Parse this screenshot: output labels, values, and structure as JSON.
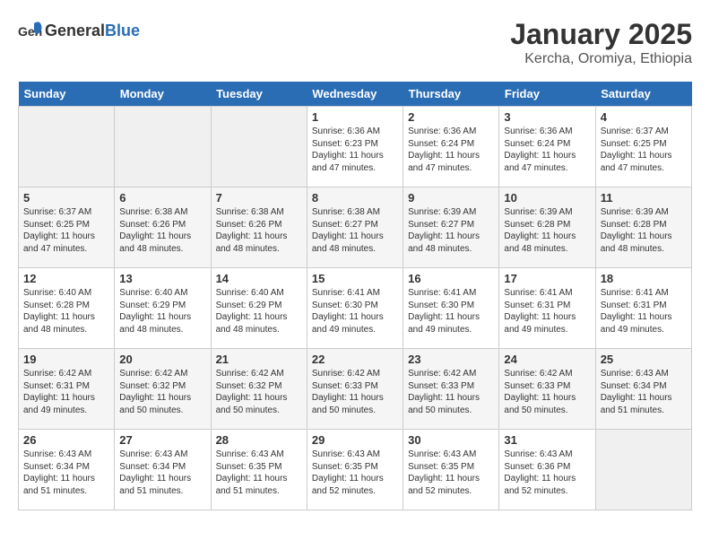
{
  "header": {
    "logo_general": "General",
    "logo_blue": "Blue",
    "title": "January 2025",
    "subtitle": "Kercha, Oromiya, Ethiopia"
  },
  "days_of_week": [
    "Sunday",
    "Monday",
    "Tuesday",
    "Wednesday",
    "Thursday",
    "Friday",
    "Saturday"
  ],
  "weeks": [
    [
      {
        "day": "",
        "info": ""
      },
      {
        "day": "",
        "info": ""
      },
      {
        "day": "",
        "info": ""
      },
      {
        "day": "1",
        "info": "Sunrise: 6:36 AM\nSunset: 6:23 PM\nDaylight: 11 hours and 47 minutes."
      },
      {
        "day": "2",
        "info": "Sunrise: 6:36 AM\nSunset: 6:24 PM\nDaylight: 11 hours and 47 minutes."
      },
      {
        "day": "3",
        "info": "Sunrise: 6:36 AM\nSunset: 6:24 PM\nDaylight: 11 hours and 47 minutes."
      },
      {
        "day": "4",
        "info": "Sunrise: 6:37 AM\nSunset: 6:25 PM\nDaylight: 11 hours and 47 minutes."
      }
    ],
    [
      {
        "day": "5",
        "info": "Sunrise: 6:37 AM\nSunset: 6:25 PM\nDaylight: 11 hours and 47 minutes."
      },
      {
        "day": "6",
        "info": "Sunrise: 6:38 AM\nSunset: 6:26 PM\nDaylight: 11 hours and 48 minutes."
      },
      {
        "day": "7",
        "info": "Sunrise: 6:38 AM\nSunset: 6:26 PM\nDaylight: 11 hours and 48 minutes."
      },
      {
        "day": "8",
        "info": "Sunrise: 6:38 AM\nSunset: 6:27 PM\nDaylight: 11 hours and 48 minutes."
      },
      {
        "day": "9",
        "info": "Sunrise: 6:39 AM\nSunset: 6:27 PM\nDaylight: 11 hours and 48 minutes."
      },
      {
        "day": "10",
        "info": "Sunrise: 6:39 AM\nSunset: 6:28 PM\nDaylight: 11 hours and 48 minutes."
      },
      {
        "day": "11",
        "info": "Sunrise: 6:39 AM\nSunset: 6:28 PM\nDaylight: 11 hours and 48 minutes."
      }
    ],
    [
      {
        "day": "12",
        "info": "Sunrise: 6:40 AM\nSunset: 6:28 PM\nDaylight: 11 hours and 48 minutes."
      },
      {
        "day": "13",
        "info": "Sunrise: 6:40 AM\nSunset: 6:29 PM\nDaylight: 11 hours and 48 minutes."
      },
      {
        "day": "14",
        "info": "Sunrise: 6:40 AM\nSunset: 6:29 PM\nDaylight: 11 hours and 48 minutes."
      },
      {
        "day": "15",
        "info": "Sunrise: 6:41 AM\nSunset: 6:30 PM\nDaylight: 11 hours and 49 minutes."
      },
      {
        "day": "16",
        "info": "Sunrise: 6:41 AM\nSunset: 6:30 PM\nDaylight: 11 hours and 49 minutes."
      },
      {
        "day": "17",
        "info": "Sunrise: 6:41 AM\nSunset: 6:31 PM\nDaylight: 11 hours and 49 minutes."
      },
      {
        "day": "18",
        "info": "Sunrise: 6:41 AM\nSunset: 6:31 PM\nDaylight: 11 hours and 49 minutes."
      }
    ],
    [
      {
        "day": "19",
        "info": "Sunrise: 6:42 AM\nSunset: 6:31 PM\nDaylight: 11 hours and 49 minutes."
      },
      {
        "day": "20",
        "info": "Sunrise: 6:42 AM\nSunset: 6:32 PM\nDaylight: 11 hours and 50 minutes."
      },
      {
        "day": "21",
        "info": "Sunrise: 6:42 AM\nSunset: 6:32 PM\nDaylight: 11 hours and 50 minutes."
      },
      {
        "day": "22",
        "info": "Sunrise: 6:42 AM\nSunset: 6:33 PM\nDaylight: 11 hours and 50 minutes."
      },
      {
        "day": "23",
        "info": "Sunrise: 6:42 AM\nSunset: 6:33 PM\nDaylight: 11 hours and 50 minutes."
      },
      {
        "day": "24",
        "info": "Sunrise: 6:42 AM\nSunset: 6:33 PM\nDaylight: 11 hours and 50 minutes."
      },
      {
        "day": "25",
        "info": "Sunrise: 6:43 AM\nSunset: 6:34 PM\nDaylight: 11 hours and 51 minutes."
      }
    ],
    [
      {
        "day": "26",
        "info": "Sunrise: 6:43 AM\nSunset: 6:34 PM\nDaylight: 11 hours and 51 minutes."
      },
      {
        "day": "27",
        "info": "Sunrise: 6:43 AM\nSunset: 6:34 PM\nDaylight: 11 hours and 51 minutes."
      },
      {
        "day": "28",
        "info": "Sunrise: 6:43 AM\nSunset: 6:35 PM\nDaylight: 11 hours and 51 minutes."
      },
      {
        "day": "29",
        "info": "Sunrise: 6:43 AM\nSunset: 6:35 PM\nDaylight: 11 hours and 52 minutes."
      },
      {
        "day": "30",
        "info": "Sunrise: 6:43 AM\nSunset: 6:35 PM\nDaylight: 11 hours and 52 minutes."
      },
      {
        "day": "31",
        "info": "Sunrise: 6:43 AM\nSunset: 6:36 PM\nDaylight: 11 hours and 52 minutes."
      },
      {
        "day": "",
        "info": ""
      }
    ]
  ]
}
